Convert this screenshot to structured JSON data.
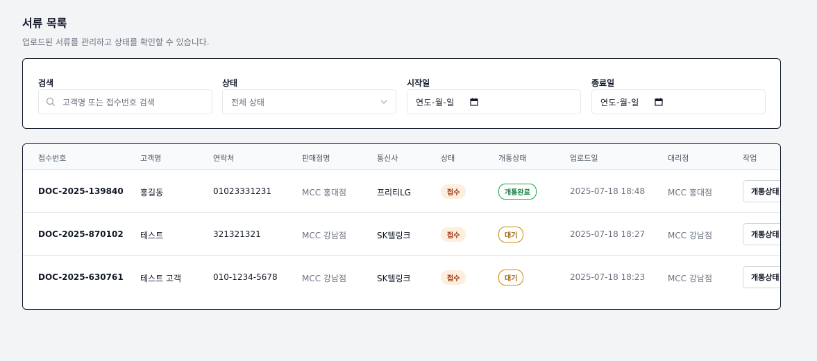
{
  "header": {
    "title": "서류 목록",
    "subtitle": "업로드된 서류를 관리하고 상태를 확인할 수 있습니다."
  },
  "filters": {
    "search_label": "검색",
    "search_placeholder": "고객명 또는 접수번호 검색",
    "status_label": "상태",
    "status_value": "전체 상태",
    "start_label": "시작일",
    "start_value": "연도-월-일",
    "end_label": "종료일",
    "end_value": "연도-월-일"
  },
  "table": {
    "columns": [
      "접수번호",
      "고객명",
      "연락처",
      "판매점명",
      "통신사",
      "상태",
      "개통상태",
      "업로드일",
      "대리점",
      "작업"
    ],
    "rows": [
      {
        "doc_no": "DOC-2025-139840",
        "customer": "홍길동",
        "phone": "01023331231",
        "store": "MCC 홍대점",
        "carrier": "프리티LG",
        "status": "접수",
        "open_status": "개통완료",
        "uploaded": "2025-07-18 18:48",
        "agency": "MCC 홍대점",
        "action": "개통상태"
      },
      {
        "doc_no": "DOC-2025-870102",
        "customer": "테스트",
        "phone": "321321321",
        "store": "MCC 강남점",
        "carrier": "SK텔링크",
        "status": "접수",
        "open_status": "대기",
        "uploaded": "2025-07-18 18:27",
        "agency": "MCC 강남점",
        "action": "개통상태"
      },
      {
        "doc_no": "DOC-2025-630761",
        "customer": "테스트 고객",
        "phone": "010-1234-5678",
        "store": "MCC 강남점",
        "carrier": "SK텔링크",
        "status": "접수",
        "open_status": "대기",
        "uploaded": "2025-07-18 18:23",
        "agency": "MCC 강남점",
        "action": "개통상태"
      }
    ]
  },
  "colors": {
    "status_badge_bg": "#fdeedd",
    "open_done": "#16a34a",
    "open_wait": "#ca8a04"
  }
}
